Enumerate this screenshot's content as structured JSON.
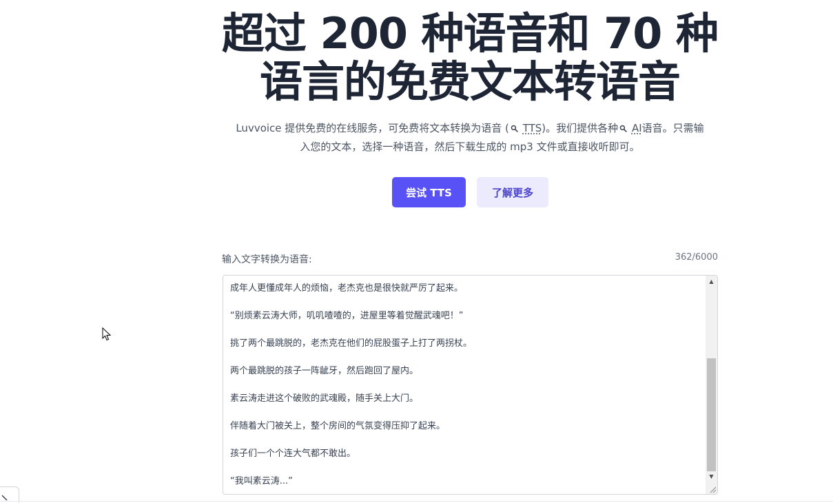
{
  "hero": {
    "title": "超过 200 种语音和 70 种语言的免费文本转语音",
    "desc_part1": "Luvvoice 提供免费的在线服务，可免费将文本转换为语音 (",
    "desc_link1": "TTS",
    "desc_part2": ")。我们提供各种",
    "desc_link2": "AI",
    "desc_part3": "语音。只需输入您的文本，选择一种语音，然后下载生成的 mp3 文件或直接收听即可。"
  },
  "buttons": {
    "try_label": "尝试 TTS",
    "learn_label": "了解更多"
  },
  "input": {
    "label": "输入文字转换为语音:",
    "char_count": "362/6000",
    "lines": [
      "成年人更懂成年人的烦恼，老杰克也是很快就严厉了起来。",
      "“别烦素云涛大师，叽叽喳喳的，进屋里等着觉醒武魂吧！”",
      "挑了两个最跳脱的，老杰克在他们的屁股蛋子上打了两拐杖。",
      "两个最跳脱的孩子一阵龇牙，然后跑回了屋内。",
      "素云涛走进这个破败的武魂殿，随手关上大门。",
      "伴随着大门被关上，整个房间的气氛变得压抑了起来。",
      "孩子们一个个连大气都不敢出。",
      "“我叫素云涛...”"
    ]
  },
  "icons": {
    "search": "search-icon",
    "cursor": "mouse-cursor-icon",
    "scroll_up": "scroll-up-arrow-icon",
    "scroll_down": "scroll-down-arrow-icon",
    "resize": "resize-grip-icon",
    "corner": "chevron-icon"
  },
  "colors": {
    "primary": "#5851f5",
    "secondary_bg": "#eceafd",
    "secondary_text": "#4a43cf",
    "title": "#1e2535"
  }
}
